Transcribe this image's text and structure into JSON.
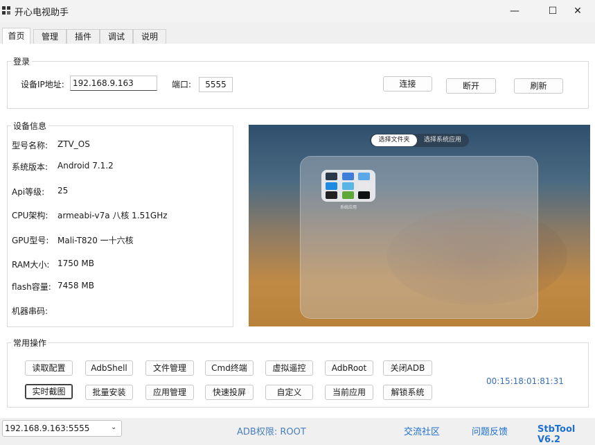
{
  "window": {
    "title": "开心电视助手",
    "minimize": "—",
    "maximize": "☐",
    "close": "✕"
  },
  "tabs": [
    "首页",
    "管理",
    "插件",
    "调试",
    "说明"
  ],
  "login": {
    "legend": "登录",
    "ip_label": "设备IP地址:",
    "ip_value": "192.168.9.163",
    "port_label": "端口:",
    "port_value": "5555",
    "connect": "连接",
    "disconnect": "断开",
    "refresh": "刷新"
  },
  "device_info": {
    "legend": "设备信息",
    "rows": [
      {
        "label": "型号名称:",
        "value": "ZTV_OS"
      },
      {
        "label": "系统版本:",
        "value": "Android 7.1.2"
      },
      {
        "label": "Api等级:",
        "value": "25"
      },
      {
        "label": "CPU架构:",
        "value": "armeabi-v7a 八核 1.51GHz"
      },
      {
        "label": "GPU型号:",
        "value": "Mali-T820 一十六核"
      },
      {
        "label": "RAM大小:",
        "value": "1750 MB"
      },
      {
        "label": "flash容量:",
        "value": "7458 MB"
      },
      {
        "label": "机器串码:",
        "value": ""
      }
    ]
  },
  "preview": {
    "toggle_selected": "选择文件夹",
    "toggle_other": "选择系统应用",
    "folder_label": "系统应用",
    "icon_colors": [
      "#2b3a4a",
      "#3d7fd8",
      "#5aa8e8",
      "#1f8be0",
      "#5ab4e6",
      "#e8e8ea",
      "#222222",
      "#5ea83a",
      "#111111"
    ]
  },
  "ops": {
    "legend": "常用操作",
    "row1": [
      "读取配置",
      "AdbShell",
      "文件管理",
      "Cmd终端",
      "虚拟遥控",
      "AdbRoot",
      "关闭ADB"
    ],
    "row2": [
      "实时截图",
      "批量安装",
      "应用管理",
      "快速投屏",
      "自定义",
      "当前应用",
      "解锁系统"
    ],
    "time": "00:15:18:01:81:31"
  },
  "status": {
    "device_select": "192.168.9.163:5555",
    "adb_permission": "ADB权限: ROOT",
    "community": "交流社区",
    "feedback": "问题反馈",
    "version": "StbTool V6.2"
  },
  "colors": {
    "link_blue": "#1e6fd0",
    "adb_blue": "#4a7fc0"
  }
}
